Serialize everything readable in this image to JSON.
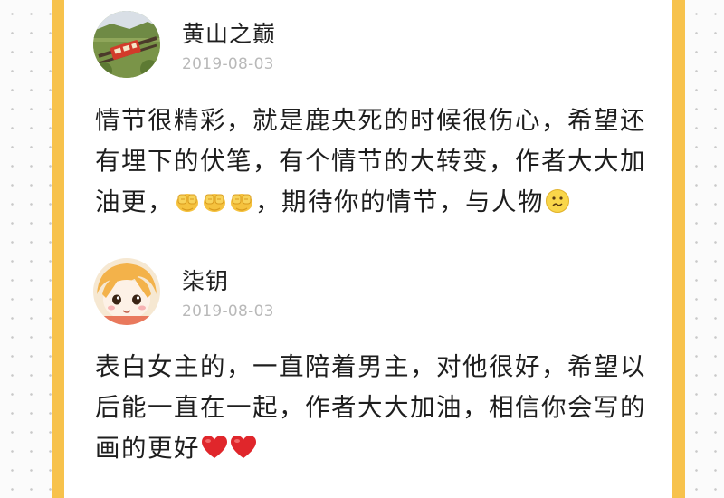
{
  "comments": [
    {
      "username": "黄山之巅",
      "date": "2019-08-03",
      "avatar_icon": "mountain-train-photo-avatar",
      "lines": [
        "情节很精彩，就是鹿央死的时候很伤心，希望还",
        "有埋下的伏笔，有个情节的大转变，作者大大加",
        "油更，",
        "，期待你的情节，与人物"
      ],
      "emojis": [
        "fist-salute-icon",
        "fist-salute-icon",
        "fist-salute-icon",
        "confused-face-icon"
      ]
    },
    {
      "username": "柒钥",
      "date": "2019-08-03",
      "avatar_icon": "anime-girl-avatar",
      "lines": [
        "表白女主的，一直陪着男主，对他很好，希望以",
        "后能一直在一起，作者大大加油，相信你会写的",
        "画的更好"
      ],
      "emojis": [
        "red-heart-icon",
        "red-heart-icon"
      ]
    }
  ],
  "colors": {
    "border_accent": "#f7c24c",
    "date_gray": "#b9b9b9",
    "heart_red": "#e0262b"
  }
}
